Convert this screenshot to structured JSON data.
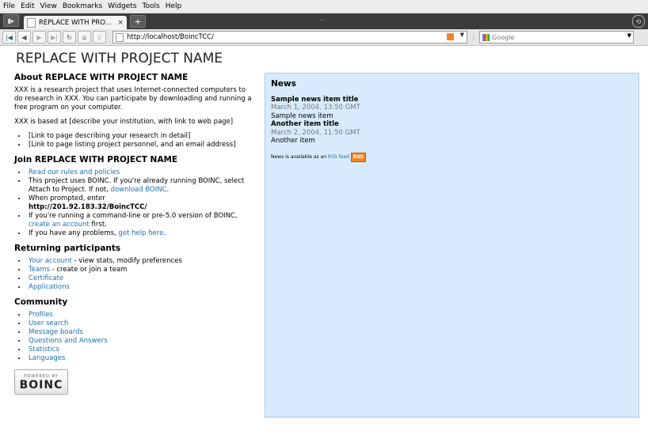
{
  "browser": {
    "menu": [
      "File",
      "Edit",
      "View",
      "Bookmarks",
      "Widgets",
      "Tools",
      "Help"
    ],
    "tab_title": "REPLACE WITH PRO...",
    "tab_close": "×",
    "new_tab": "+",
    "dots": "...",
    "url": "http://localhost/BoincTCC/",
    "search_placeholder": "Google"
  },
  "page": {
    "title": "REPLACE WITH PROJECT NAME",
    "about": {
      "heading": "About REPLACE WITH PROJECT NAME",
      "para1": "XXX is a research project that uses Internet-connected computers to do research in XXX. You can participate by downloading and running a free program on your computer.",
      "para2": "XXX is based at [describe your institution, with link to web page]",
      "items": [
        "[Link to page describing your research in detail]",
        "[Link to page listing project personnel, and an email address]"
      ]
    },
    "join": {
      "heading": "Join REPLACE WITH PROJECT NAME",
      "rules_link": "Read our rules and policies",
      "boinc_text": "This project uses BOINC. If you're already running BOINC, select Attach to Project. If not, ",
      "download_link": "download BOINC",
      "dot": ".",
      "prompt_text": "When prompted, enter",
      "project_url": "http://201.92.183.32/BoincTCC/",
      "cmdline_text": "If you're running a command-line or pre-5.0 version of BOINC, ",
      "create_link": "create an account",
      "first_text": " first.",
      "problems_text": "If you have any problems, ",
      "help_link": "get help here",
      "period": "."
    },
    "returning": {
      "heading": "Returning participants",
      "account_link": "Your account",
      "account_text": " - view stats, modify preferences",
      "teams_link": "Teams",
      "teams_text": " - create or join a team",
      "certificate_link": "Certificate",
      "applications_link": "Applications"
    },
    "community": {
      "heading": "Community",
      "links": [
        "Profiles",
        "User search",
        "Message boards",
        "Questions and Answers",
        "Statistics",
        "Languages"
      ]
    },
    "logo": {
      "top": "POWERED BY",
      "name": "BOINC"
    },
    "news": {
      "heading": "News",
      "items": [
        {
          "title": "Sample news item title",
          "date": "March 1, 2004, 13:50 GMT",
          "body": "Sample news item"
        },
        {
          "title": "Another item title",
          "date": "March 2, 2004, 11:50 GMT",
          "body": "Another item"
        }
      ],
      "rss_text": "News is available as an ",
      "rss_link": "RSS feed",
      "rss_badge": "RSS"
    }
  }
}
